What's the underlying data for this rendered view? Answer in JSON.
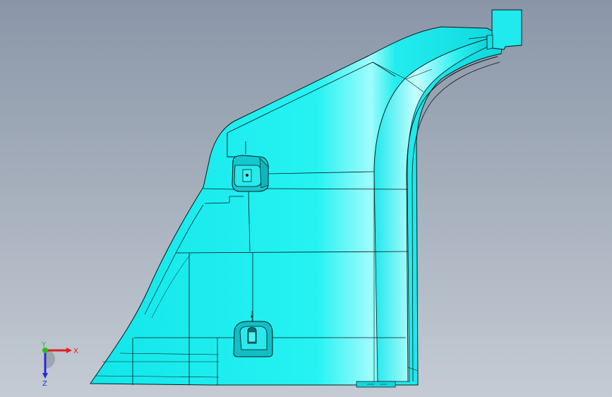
{
  "viewport": {
    "background_top": "#8a96a8",
    "background_bottom": "#c4cbd4"
  },
  "model": {
    "fill_color": "#22f0f0",
    "highlight_color": "#9ffcfc",
    "edge_color": "#0a1a1a"
  },
  "triad": {
    "x_label": "X",
    "y_label": "Y",
    "z_label": "Z",
    "x_color": "#e02020",
    "y_color": "#20c020",
    "z_color": "#2030d0"
  }
}
